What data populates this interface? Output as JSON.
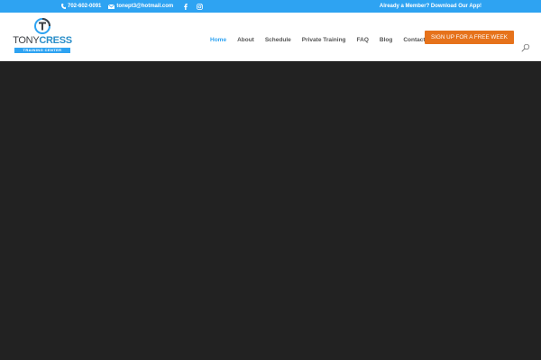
{
  "topbar": {
    "phone": "702-602-0091",
    "email": "tonept3@hotmail.com",
    "cta_text": "Already a Member? Download Our App!",
    "icons": [
      "phone-icon",
      "envelope-icon",
      "facebook-icon",
      "instagram-icon"
    ]
  },
  "logo": {
    "word1": "TONY",
    "word2": "CRESS",
    "tagline": "TRAINING CENTER"
  },
  "nav": {
    "items": [
      {
        "label": "Home",
        "active": true
      },
      {
        "label": "About"
      },
      {
        "label": "Schedule"
      },
      {
        "label": "Private Training"
      },
      {
        "label": "FAQ"
      },
      {
        "label": "Blog"
      },
      {
        "label": "Contact"
      }
    ]
  },
  "cta_button": {
    "label": "SIGN UP FOR A FREE WEEK"
  },
  "search": {
    "icon": "search-icon"
  },
  "colors": {
    "accent": "#2ea3f2",
    "cta": "#e6721b",
    "hero": "#222222",
    "nav_text": "#555555"
  }
}
